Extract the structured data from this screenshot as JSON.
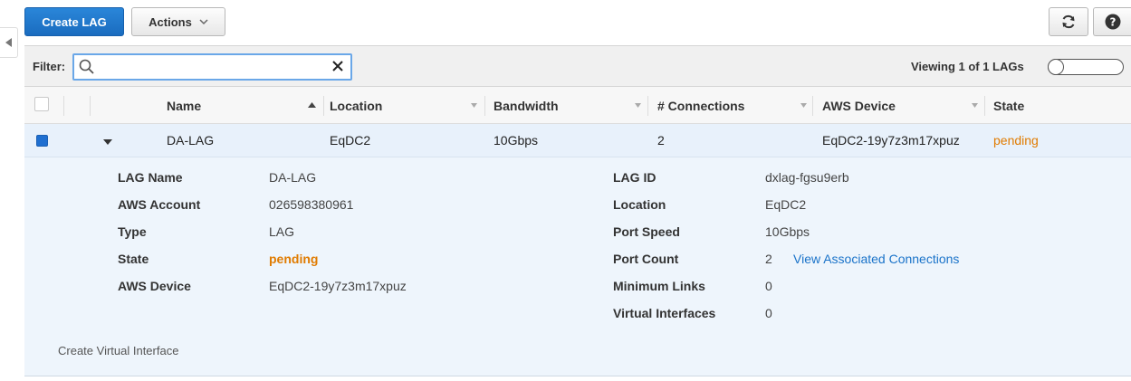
{
  "toolbar": {
    "create_label": "Create LAG",
    "actions_label": "Actions"
  },
  "filter": {
    "label": "Filter:",
    "value": "",
    "placeholder": "",
    "viewing_text": "Viewing 1 of 1 LAGs"
  },
  "table": {
    "columns": [
      "Name",
      "Location",
      "Bandwidth",
      "# Connections",
      "AWS Device",
      "State"
    ],
    "rows": [
      {
        "name": "DA-LAG",
        "location": "EqDC2",
        "bandwidth": "10Gbps",
        "connections": "2",
        "aws_device": "EqDC2-19y7z3m17xpuz",
        "state": "pending",
        "selected": true,
        "expanded": true
      }
    ]
  },
  "detail": {
    "left": [
      {
        "label": "LAG Name",
        "value": "DA-LAG"
      },
      {
        "label": "AWS Account",
        "value": "026598380961"
      },
      {
        "label": "Type",
        "value": "LAG"
      },
      {
        "label": "State",
        "value": "pending"
      },
      {
        "label": "AWS Device",
        "value": "EqDC2-19y7z3m17xpuz"
      }
    ],
    "right": [
      {
        "label": "LAG ID",
        "value": "dxlag-fgsu9erb"
      },
      {
        "label": "Location",
        "value": "EqDC2"
      },
      {
        "label": "Port Speed",
        "value": "10Gbps"
      },
      {
        "label": "Port Count",
        "value": "2",
        "link": "View Associated Connections"
      },
      {
        "label": "Minimum Links",
        "value": "0"
      },
      {
        "label": "Virtual Interfaces",
        "value": "0"
      }
    ],
    "create_vi_label": "Create Virtual Interface"
  },
  "colors": {
    "primary": "#1a6cbf",
    "pending": "#e07b00",
    "link": "#1a73c9",
    "selected_row": "#e8f1fb"
  }
}
